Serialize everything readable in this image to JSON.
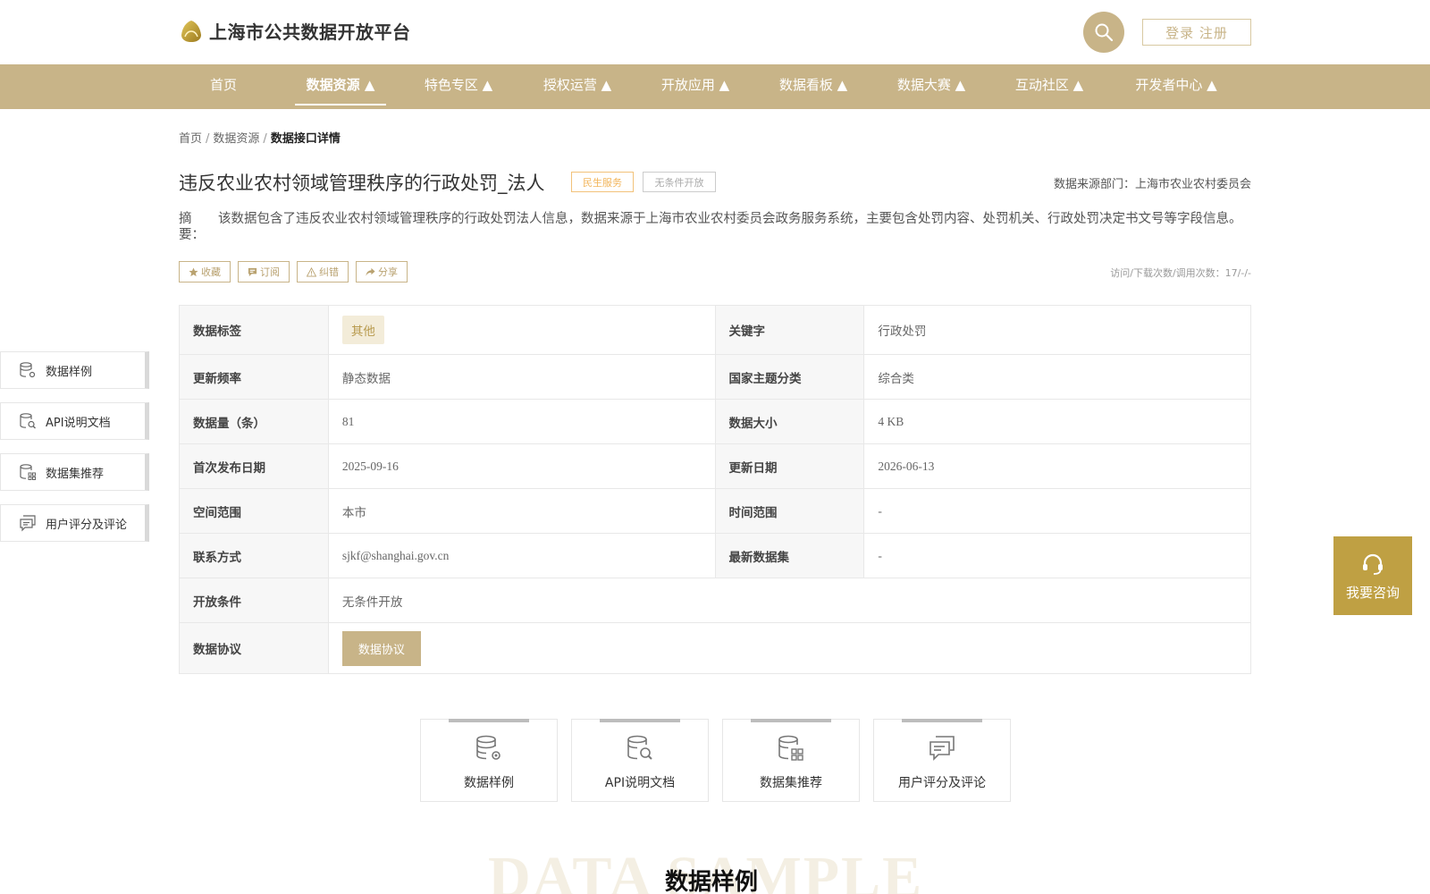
{
  "header": {
    "site_title": "上海市公共数据开放平台",
    "login_label": "登录 注册"
  },
  "nav": {
    "items": [
      {
        "label": "首页"
      },
      {
        "label": "数据资源 ▲"
      },
      {
        "label": "特色专区 ▲"
      },
      {
        "label": "授权运营 ▲"
      },
      {
        "label": "开放应用 ▲"
      },
      {
        "label": "数据看板 ▲"
      },
      {
        "label": "数据大赛 ▲"
      },
      {
        "label": "互动社区 ▲"
      },
      {
        "label": "开发者中心 ▲"
      }
    ],
    "active_index": 1
  },
  "breadcrumb": {
    "home": "首页",
    "resources": "数据资源",
    "current": "数据接口详情"
  },
  "dataset": {
    "title": "违反农业农村领域管理秩序的行政处罚_法人",
    "tag_service": "民生服务",
    "tag_open": "无条件开放",
    "source": "数据来源部门：上海市农业农村委员会",
    "summary_label": "摘　　要：",
    "summary": "该数据包含了违反农业农村领域管理秩序的行政处罚法人信息，数据来源于上海市农业农村委员会政务服务系统，主要包含处罚内容、处罚机关、行政处罚决定书文号等字段信息。"
  },
  "actions": {
    "favorite": "收藏",
    "subscribe": "订阅",
    "report": "纠错",
    "share": "分享",
    "stats": "访问/下载次数/调用次数：17/-/-"
  },
  "info": {
    "tag_label": "数据标签",
    "tag_value": "其他",
    "keyword_label": "关键字",
    "keyword_value": "行政处罚",
    "freq_label": "更新频率",
    "freq_value": "静态数据",
    "theme_label": "国家主题分类",
    "theme_value": "综合类",
    "count_label": "数据量（条）",
    "count_value": "81",
    "size_label": "数据大小",
    "size_value": "4 KB",
    "first_pub_label": "首次发布日期",
    "first_pub_value": "2025-09-16",
    "update_label": "更新日期",
    "update_value": "2026-06-13",
    "space_label": "空间范围",
    "space_value": "本市",
    "time_label": "时间范围",
    "time_value": "-",
    "contact_label": "联系方式",
    "contact_value": "sjkf@shanghai.gov.cn",
    "latest_label": "最新数据集",
    "latest_value": "-",
    "open_cond_label": "开放条件",
    "open_cond_value": "无条件开放",
    "protocol_label": "数据协议",
    "protocol_button": "数据协议"
  },
  "side_menu": {
    "items": [
      {
        "label": "数据样例",
        "icon": "database-gear-icon"
      },
      {
        "label": "API说明文档",
        "icon": "database-search-icon"
      },
      {
        "label": "数据集推荐",
        "icon": "database-grid-icon"
      },
      {
        "label": "用户评分及评论",
        "icon": "comment-icon"
      }
    ]
  },
  "consult": {
    "label": "我要咨询",
    "icon": "headset-icon"
  },
  "cards": {
    "items": [
      {
        "label": "数据样例",
        "icon": "database-gear-icon"
      },
      {
        "label": "API说明文档",
        "icon": "database-search-icon"
      },
      {
        "label": "数据集推荐",
        "icon": "database-grid-icon"
      },
      {
        "label": "用户评分及评论",
        "icon": "comment-icon"
      }
    ]
  },
  "section": {
    "bg_word": "DATA SAMPLE",
    "title": "数据样例"
  },
  "colors": {
    "brand_gold": "#c8b488",
    "accent_gold": "#bfa043",
    "tag_orange": "#f2b45a"
  }
}
